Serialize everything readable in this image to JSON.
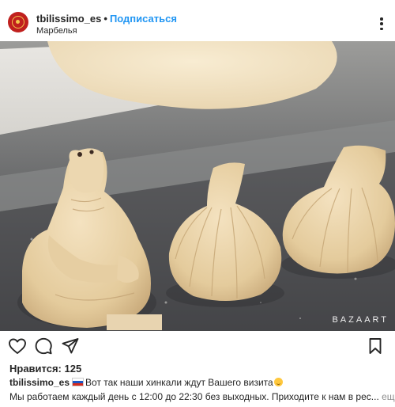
{
  "header": {
    "username": "tbilissimo_es",
    "separator": "•",
    "follow_label": "Подписаться",
    "location": "Марбелья"
  },
  "post": {
    "watermark": "BAZAART",
    "image_subject": "khinkali dumplings on a baking tray with a dough figure"
  },
  "actions": {
    "icons": [
      "heart-icon",
      "comment-icon",
      "share-icon",
      "bookmark-icon"
    ]
  },
  "likes": {
    "text": "Нравится: 125"
  },
  "caption": {
    "username": "tbilissimo_es",
    "line1": "Вот так наши хинкали ждут Вашего визита",
    "line2": "Мы работаем каждый день с 12:00 до 22:30 без выходных. Приходите к нам в рес...",
    "more_label": "ещё"
  },
  "colors": {
    "accent": "#2196f3",
    "text": "#262626",
    "muted": "#8e8e8e",
    "avatar_bg": "#c0201e"
  }
}
